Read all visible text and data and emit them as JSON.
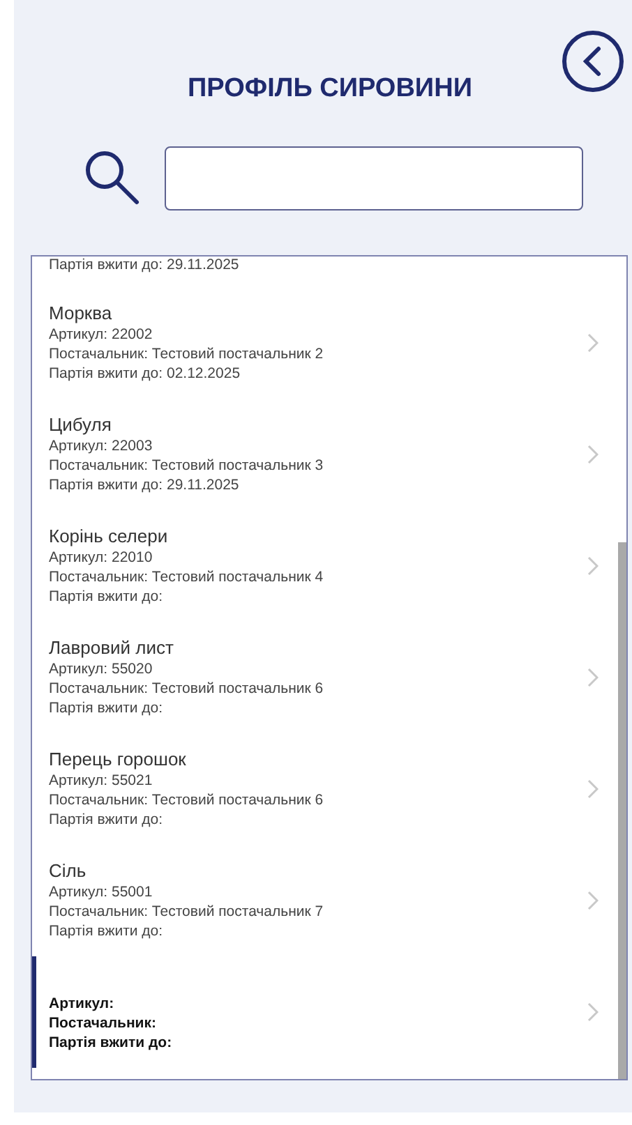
{
  "header": {
    "title": "ПРОФІЛЬ СИРОВИНИ"
  },
  "list": {
    "top_line": "Партія вжити до: 29.11.2025",
    "items": [
      {
        "name": "Морква",
        "lines": [
          "Артикул: 22002",
          "Постачальник: Тестовий постачальник 2",
          "Партія вжити до: 02.12.2025"
        ],
        "selected": false
      },
      {
        "name": "Цибуля",
        "lines": [
          "Артикул: 22003",
          "Постачальник: Тестовий постачальник 3",
          "Партія вжити до: 29.11.2025"
        ],
        "selected": false
      },
      {
        "name": "Корінь селери",
        "lines": [
          "Артикул: 22010",
          "Постачальник: Тестовий постачальник 4",
          "Партія вжити до:"
        ],
        "selected": false
      },
      {
        "name": "Лавровий лист",
        "lines": [
          "Артикул: 55020",
          "Постачальник: Тестовий постачальник 6",
          "Партія вжити до:"
        ],
        "selected": false
      },
      {
        "name": "Перець горошок",
        "lines": [
          "Артикул: 55021",
          "Постачальник: Тестовий постачальник 6",
          "Партія вжити до:"
        ],
        "selected": false
      },
      {
        "name": "Сіль",
        "lines": [
          "Артикул: 55001",
          "Постачальник: Тестовий постачальник 7",
          "Партія вжити до:"
        ],
        "selected": false
      },
      {
        "lines": [
          "Артикул:",
          "Постачальник:",
          "Партія вжити до:"
        ],
        "selected": true
      }
    ]
  }
}
